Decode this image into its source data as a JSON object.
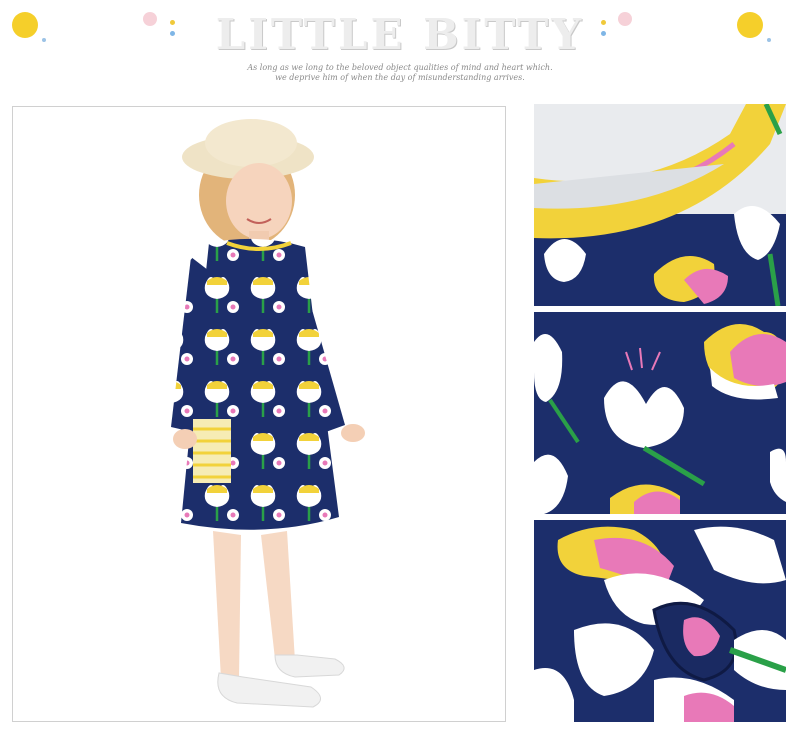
{
  "header": {
    "title": "LITTLE BITTY",
    "tagline_line1": "As long as we long to the beloved object qualities of mind and heart which.",
    "tagline_line2": "we deprive him of when the day of misunderstanding arrives."
  },
  "colors": {
    "navy": "#1c2e6b",
    "yellow": "#f2d23a",
    "pink": "#e879b8",
    "green": "#2aa048",
    "white": "#ffffff",
    "title_gray": "#ededed"
  },
  "images": {
    "main": "girl-in-floral-dress-photo",
    "details": [
      "collar-detail-photo",
      "print-detail-photo",
      "fabric-fold-detail-photo"
    ]
  }
}
